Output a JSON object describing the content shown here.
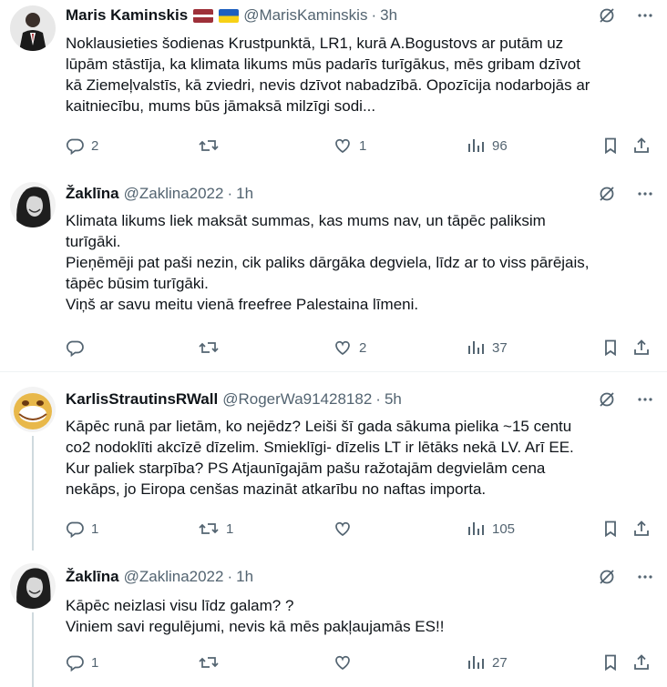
{
  "tweets": [
    {
      "name": "Maris Kaminskis",
      "handle": "@MarisKaminskis",
      "dot": "·",
      "time": "3h",
      "flags": [
        "latvia-flag",
        "ukraine-flag"
      ],
      "text": "Noklausieties šodienas Krustpunktā, LR1, kurā A.Bogustovs ar putām uz\nlūpām stāstīja, ka klimata likums mūs padarīs turīgākus, mēs gribam dzīvot\nkā Ziemeļvalstīs, kā zviedri, nevis dzīvot nabadzībā. Opozīcija nodarbojās ar\nkaitniecību, mums būs jāmaksā milzīgi sodi...",
      "replies": "2",
      "retweets": "",
      "likes": "1",
      "views": "96"
    },
    {
      "name": "Žaklīna",
      "handle": "@Zaklina2022",
      "dot": "·",
      "time": "1h",
      "text": "Klimata likums liek maksāt summas, kas mums nav, un tāpēc paliksim\nturīgāki.\nPieņēmēji pat paši nezin, cik paliks dārgāka degviela, līdz ar to viss pārējais,\ntāpēc būsim turīgāki.\nViņš ar savu meitu vienā freefree Palestaina līmeni.",
      "replies": "",
      "retweets": "",
      "likes": "2",
      "views": "37"
    },
    {
      "name": "KarlisStrautinsRWall",
      "handle": "@RogerWa91428182",
      "dot": "·",
      "time": "5h",
      "text": "Kāpēc runā par lietām, ko nejēdz? Leiši šī gada sākuma pielika ~15 centu\nco2 nodoklīti akcīzē dīzelim. Smieklīgi- dīzelis LT ir lētāks nekā LV. Arī EE.\nKur paliek starpība?  PS Atjaunīgajām pašu ražotajām degvielām cena\nnekāps, jo Eiropa cenšas mazināt atkarību no naftas importa.",
      "replies": "1",
      "retweets": "1",
      "likes": "",
      "views": "105"
    },
    {
      "name": "Žaklīna",
      "handle": "@Zaklina2022",
      "dot": "·",
      "time": "1h",
      "text": "Kāpēc neizlasi visu līdz galam? ?\nViniem savi regulējumi, nevis kā mēs pakļaujamās ES!!",
      "replies": "1",
      "retweets": "",
      "likes": "",
      "views": "27"
    }
  ],
  "colors": {
    "text": "#0f1419",
    "secondary": "#536471",
    "divider": "#eff3f4",
    "thread_line": "#cfd9de"
  },
  "icons": [
    "grok-icon",
    "more-icon",
    "reply-icon",
    "retweet-icon",
    "like-icon",
    "views-icon",
    "bookmark-icon",
    "share-icon"
  ]
}
